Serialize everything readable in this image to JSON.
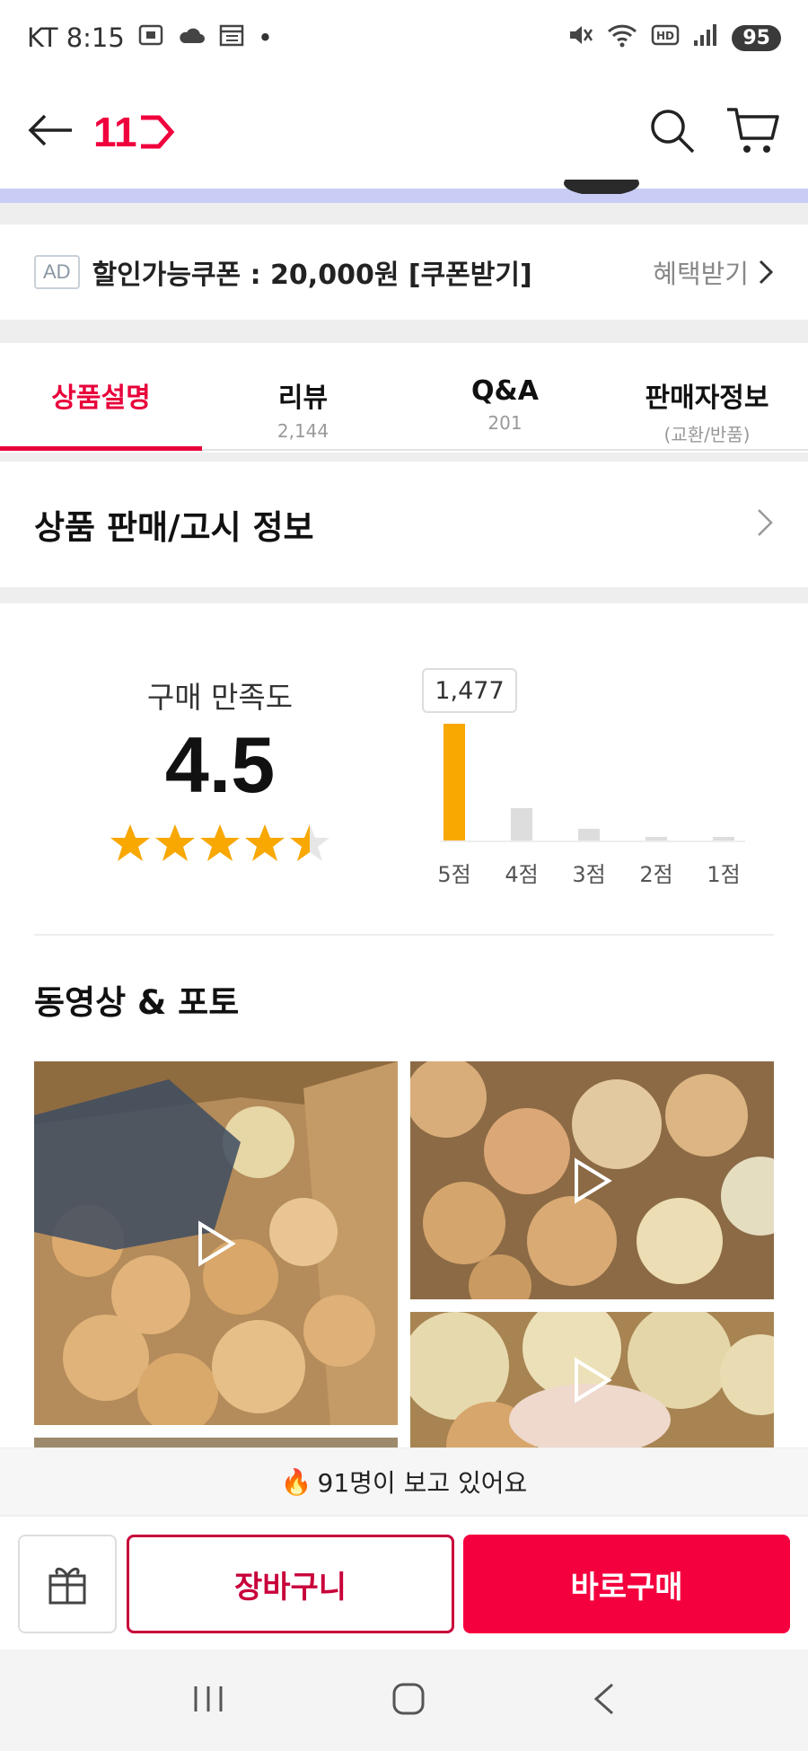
{
  "status": {
    "carrier_time": "KT 8:15",
    "battery": "95",
    "dot": "•"
  },
  "header": {
    "logo_text": "11"
  },
  "ad": {
    "badge": "AD",
    "text": "할인가능쿠폰 : 20,000원 [쿠폰받기]",
    "benefit": "혜택받기"
  },
  "tabs": [
    {
      "label": "상품설명",
      "sub": ""
    },
    {
      "label": "리뷰",
      "sub": "2,144"
    },
    {
      "label": "Q&A",
      "sub": "201"
    },
    {
      "label": "판매자정보",
      "sub": "(교환/반품)"
    }
  ],
  "sale_info": {
    "title": "상품 판매/고시 정보"
  },
  "rating": {
    "label": "구매 만족도",
    "score": "4.5",
    "stars_value": 4.5,
    "max_stars": 5
  },
  "chart_data": {
    "type": "bar",
    "categories": [
      "5점",
      "4점",
      "3점",
      "2점",
      "1점"
    ],
    "values": [
      1477,
      410,
      150,
      45,
      30
    ],
    "tooltip": "1,477",
    "highlight_color": "#f8a800",
    "base_color": "#dddddd"
  },
  "media": {
    "title": "동영상 & 포토"
  },
  "viewers": {
    "icon": "🔥",
    "text": "91명이 보고 있어요"
  },
  "bottom": {
    "cart_label": "장바구니",
    "buy_label": "바로구매"
  },
  "colors": {
    "accent": "#e8003a",
    "buy": "#f5003f",
    "star": "#f8a800"
  }
}
